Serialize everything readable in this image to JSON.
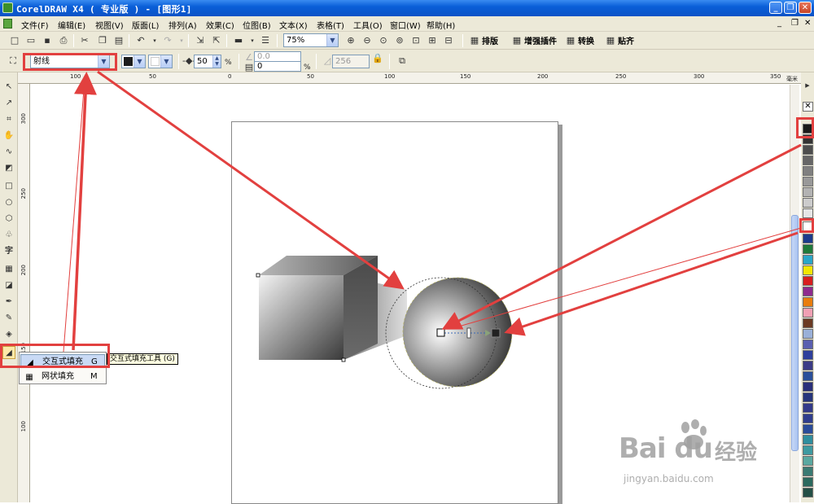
{
  "window": {
    "title": "CorelDRAW X4 ( 专业版 ) - [图形1]"
  },
  "menubar": {
    "items": [
      "文件(F)",
      "编辑(E)",
      "视图(V)",
      "版面(L)",
      "排列(A)",
      "效果(C)",
      "位图(B)",
      "文本(X)",
      "表格(T)",
      "工具(O)",
      "窗口(W)",
      "帮助(H)"
    ]
  },
  "standard_toolbar": {
    "zoom": "75%",
    "labels": [
      "排版",
      "增强插件",
      "转换",
      "贴齐"
    ]
  },
  "property_bar": {
    "fill_type": "射线",
    "midpoint": "50",
    "midpoint_unit": "%",
    "angle": "0.0",
    "edge_pad": "0",
    "edge_pad_unit": "%",
    "steps": "256"
  },
  "rulers": {
    "h_labels": [
      "100",
      "50",
      "0",
      "50",
      "100",
      "150",
      "200",
      "250",
      "300",
      "350"
    ],
    "v_labels": [
      "300",
      "250",
      "200",
      "150",
      "100"
    ],
    "unit": "毫米"
  },
  "flyout": {
    "items": [
      {
        "label": "交互式填充",
        "key": "G"
      },
      {
        "label": "网状填充",
        "key": "M"
      }
    ]
  },
  "tooltip": "交互式填充工具 (G)",
  "colors": {
    "accent_red": "#e2403f",
    "title_blue": "#0b5fd8"
  },
  "watermark": {
    "brand": "Bai  du",
    "cn": "经验",
    "url": "jingyan.baidu.com"
  }
}
